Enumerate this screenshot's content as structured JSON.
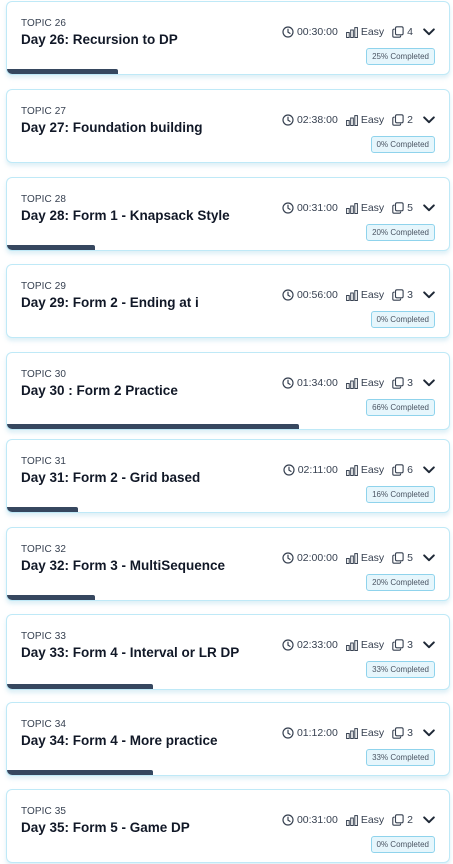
{
  "topics": [
    {
      "topic": "TOPIC 26",
      "title": "Day 26: Recursion to DP",
      "duration": "00:30:00",
      "difficulty": "Easy",
      "count": "4",
      "completion": "25% Completed",
      "progress": 0.25
    },
    {
      "topic": "TOPIC 27",
      "title": "Day 27: Foundation building",
      "duration": "02:38:00",
      "difficulty": "Easy",
      "count": "2",
      "completion": "0% Completed",
      "progress": 0
    },
    {
      "topic": "TOPIC 28",
      "title": "Day 28: Form 1 - Knapsack Style",
      "duration": "00:31:00",
      "difficulty": "Easy",
      "count": "5",
      "completion": "20% Completed",
      "progress": 0.2
    },
    {
      "topic": "TOPIC 29",
      "title": "Day 29: Form 2 - Ending at i",
      "duration": "00:56:00",
      "difficulty": "Easy",
      "count": "3",
      "completion": "0% Completed",
      "progress": 0
    },
    {
      "topic": "TOPIC 30",
      "title": "Day 30 : Form 2 Practice",
      "duration": "01:34:00",
      "difficulty": "Easy",
      "count": "3",
      "completion": "66% Completed",
      "progress": 0.66
    },
    {
      "topic": "TOPIC 31",
      "title": "Day 31: Form 2 - Grid based",
      "duration": "02:11:00",
      "difficulty": "Easy",
      "count": "6",
      "completion": "16% Completed",
      "progress": 0.16
    },
    {
      "topic": "TOPIC 32",
      "title": "Day 32: Form 3 - MultiSequence",
      "duration": "02:00:00",
      "difficulty": "Easy",
      "count": "5",
      "completion": "20% Completed",
      "progress": 0.2
    },
    {
      "topic": "TOPIC 33",
      "title": "Day 33: Form 4 - Interval or LR DP",
      "duration": "02:33:00",
      "difficulty": "Easy",
      "count": "3",
      "completion": "33% Completed",
      "progress": 0.33
    },
    {
      "topic": "TOPIC 34",
      "title": "Day 34: Form 4 - More practice",
      "duration": "01:12:00",
      "difficulty": "Easy",
      "count": "3",
      "completion": "33% Completed",
      "progress": 0.33
    },
    {
      "topic": "TOPIC 35",
      "title": "Day 35: Form 5 - Game DP",
      "duration": "00:31:00",
      "difficulty": "Easy",
      "count": "2",
      "completion": "0% Completed",
      "progress": 0
    }
  ],
  "icons": {
    "duration": "clock-icon",
    "difficulty": "bar-chart-icon",
    "count": "copy-icon",
    "expand": "chevron-down-icon"
  },
  "colors": {
    "progress": "#36475f",
    "card_border": "#bfe9f7",
    "badge_bg": "#e6f6fc",
    "badge_border": "#8fd3ec"
  }
}
